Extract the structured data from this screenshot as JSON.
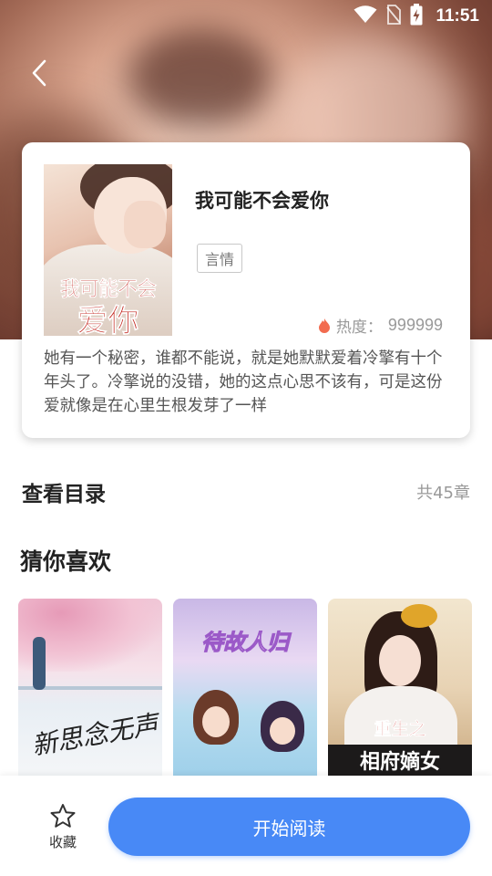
{
  "status_bar": {
    "time": "11:51"
  },
  "book": {
    "title": "我可能不会爱你",
    "tag": "言情",
    "heat_label": "热度：",
    "heat_value": "999999",
    "description": "她有一个秘密，谁都不能说，就是她默默爱着冷擎有十个年头了。冷擎说的没错，她的这点心思不该有，可是这份爱就像是在心里生根发芽了一样",
    "cover_text_line1": "我可能不会",
    "cover_text_line2": "爱你"
  },
  "catalog": {
    "label": "查看目录",
    "count": "共45章"
  },
  "recommend": {
    "title": "猜你喜欢",
    "items": [
      {
        "cover_text": "新思念无声"
      },
      {
        "cover_text": "待故人归"
      },
      {
        "cover_text_sub": "重生之",
        "cover_text_main": "相府嫡女"
      }
    ]
  },
  "bottom_bar": {
    "favorite_label": "收藏",
    "read_button": "开始阅读"
  },
  "colors": {
    "accent": "#4889f6",
    "heat_icon": "#f26b4f"
  }
}
